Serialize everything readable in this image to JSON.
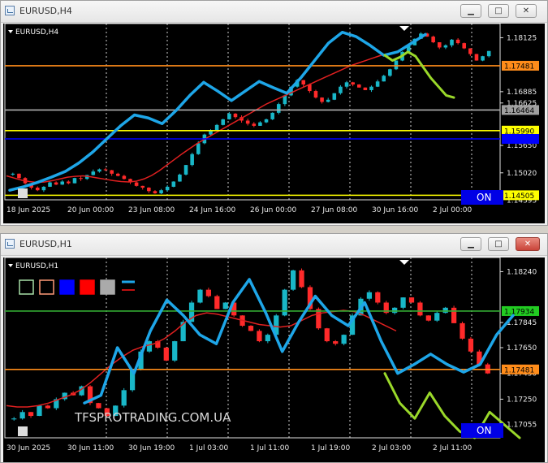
{
  "windows": [
    {
      "title": "EURUSD,H4",
      "symbol_label": "EURUSD,H4",
      "on_label": "ON",
      "chart_data": {
        "type": "candlestick",
        "symbol": "EURUSD",
        "timeframe": "H4",
        "ylim": [
          1.144,
          1.1845
        ],
        "y_ticks": [
          "1.18125",
          "1.16885",
          "1.16625",
          "1.15650",
          "1.15020",
          "1.14395"
        ],
        "y_tick_values": [
          1.18125,
          1.16885,
          1.16625,
          1.1565,
          1.1502,
          1.14395
        ],
        "x_ticks": [
          "18 Jun 2025",
          "20 Jun 00:00",
          "23 Jun 08:00",
          "24 Jun 16:00",
          "26 Jun 00:00",
          "27 Jun 08:00",
          "30 Jun 16:00",
          "2 Jul 00:00"
        ],
        "close_series": [
          1.15,
          1.149,
          1.1478,
          1.1468,
          1.1462,
          1.147,
          1.148,
          1.1475,
          1.1482,
          1.1478,
          1.149,
          1.1488,
          1.1497,
          1.1505,
          1.151,
          1.1508,
          1.15,
          1.1495,
          1.1488,
          1.148,
          1.1472,
          1.1468,
          1.146,
          1.1455,
          1.1462,
          1.147,
          1.1482,
          1.1498,
          1.152,
          1.1545,
          1.157,
          1.159,
          1.16,
          1.1612,
          1.1625,
          1.1638,
          1.163,
          1.1622,
          1.1615,
          1.161,
          1.1618,
          1.1625,
          1.164,
          1.166,
          1.168,
          1.17,
          1.1715,
          1.1705,
          1.169,
          1.1675,
          1.1665,
          1.167,
          1.1685,
          1.17,
          1.171,
          1.1705,
          1.1698,
          1.1692,
          1.17,
          1.1712,
          1.1725,
          1.174,
          1.176,
          1.178,
          1.1795,
          1.181,
          1.1822,
          1.1815,
          1.1802,
          1.179,
          1.1795,
          1.1808,
          1.18,
          1.1788,
          1.1775,
          1.176,
          1.177,
          1.1782
        ],
        "ma_series": [
          1.1495,
          1.149,
          1.1485,
          1.1482,
          1.148,
          1.1481,
          1.1484,
          1.1488,
          1.1492,
          1.1494,
          1.1495,
          1.1493,
          1.149,
          1.1487,
          1.1484,
          1.1482,
          1.1481,
          1.1483,
          1.1488,
          1.1496,
          1.1507,
          1.152,
          1.1533,
          1.1546,
          1.1558,
          1.157,
          1.158,
          1.159,
          1.16,
          1.161,
          1.162,
          1.163,
          1.164,
          1.165,
          1.166,
          1.1668,
          1.1676,
          1.1684,
          1.1692,
          1.17,
          1.1708,
          1.1716,
          1.1724,
          1.1732,
          1.174,
          1.1748,
          1.1754,
          1.176,
          1.1766,
          1.1772,
          1.1776,
          1.178
        ],
        "sketch_blue": [
          1.1462,
          1.147,
          1.148,
          1.1492,
          1.1505,
          1.1525,
          1.155,
          1.158,
          1.161,
          1.1635,
          1.1628,
          1.1615,
          1.1645,
          1.168,
          1.171,
          1.169,
          1.1668,
          1.169,
          1.1712,
          1.1698,
          1.1685,
          1.172,
          1.176,
          1.18,
          1.1825,
          1.1815,
          1.1795,
          1.1772,
          1.178,
          1.18,
          1.182
        ],
        "sketch_green": [
          1.1772,
          1.176,
          1.1768,
          1.178,
          1.177,
          1.1745,
          1.172,
          1.17,
          1.168,
          1.1675
        ],
        "hlines": [
          {
            "value": 1.17481,
            "label": "1.17481",
            "color": "#ff8c1a",
            "label_bg": "#ff8c1a"
          },
          {
            "value": 1.16464,
            "label": "1.16464",
            "color": "#b0b0b0",
            "label_bg": "#a0a0a0"
          },
          {
            "value": 1.1599,
            "label": "1.15990",
            "color": "#ffff00",
            "label_bg": "#ffff00"
          },
          {
            "value": 1.158,
            "label": "",
            "color": "#0000ff",
            "label_bg": "#0000ff"
          },
          {
            "value": 1.14505,
            "label": "1.14505",
            "color": "#ffff00",
            "label_bg": "#ffff00"
          }
        ]
      }
    },
    {
      "title": "EURUSD,H1",
      "symbol_label": "EURUSD,H1",
      "on_label": "ON",
      "watermark": "TFSPROTRADING.COM.UA",
      "chart_data": {
        "type": "candlestick",
        "symbol": "EURUSD",
        "timeframe": "H1",
        "ylim": [
          1.1695,
          1.1835
        ],
        "y_ticks": [
          "1.18240",
          "1.17845",
          "1.17650",
          "1.17450",
          "1.17250",
          "1.17055"
        ],
        "y_tick_values": [
          1.1824,
          1.17845,
          1.1765,
          1.1745,
          1.1725,
          1.17055
        ],
        "x_ticks": [
          "30 Jun 2025",
          "30 Jun 11:00",
          "30 Jun 19:00",
          "1 Jul 03:00",
          "1 Jul 11:00",
          "1 Jul 19:00",
          "2 Jul 03:00",
          "2 Jul 11:00"
        ],
        "close_series": [
          1.171,
          1.1715,
          1.1712,
          1.172,
          1.1718,
          1.1725,
          1.173,
          1.1728,
          1.1735,
          1.1722,
          1.1718,
          1.1712,
          1.172,
          1.1732,
          1.1748,
          1.1762,
          1.177,
          1.1765,
          1.1755,
          1.177,
          1.1785,
          1.18,
          1.181,
          1.1805,
          1.1795,
          1.18,
          1.179,
          1.1782,
          1.1778,
          1.177,
          1.1775,
          1.179,
          1.181,
          1.1825,
          1.1812,
          1.1795,
          1.178,
          1.177,
          1.1768,
          1.1775,
          1.179,
          1.1803,
          1.1808,
          1.18,
          1.1792,
          1.1796,
          1.1804,
          1.18,
          1.179,
          1.1786,
          1.1792,
          1.1796,
          1.1784,
          1.1772,
          1.1762,
          1.1752,
          1.1745
        ],
        "ma_series": [
          1.172,
          1.1719,
          1.1719,
          1.172,
          1.1722,
          1.1725,
          1.1728,
          1.1732,
          1.1738,
          1.1745,
          1.1752,
          1.1758,
          1.1763,
          1.1766,
          1.1768,
          1.1772,
          1.1778,
          1.1785,
          1.179,
          1.1792,
          1.1791,
          1.1789,
          1.1787,
          1.1785,
          1.1783,
          1.1782,
          1.1781,
          1.1782,
          1.1786,
          1.179,
          1.1792,
          1.1793,
          1.1794,
          1.1793,
          1.179,
          1.1786,
          1.1782,
          1.1778
        ],
        "sketch_blue": [
          1.1722,
          1.1728,
          1.1765,
          1.1745,
          1.1778,
          1.1802,
          1.179,
          1.1775,
          1.1768,
          1.18,
          1.1818,
          1.1792,
          1.1762,
          1.1785,
          1.1805,
          1.179,
          1.1782,
          1.18,
          1.177,
          1.1745,
          1.1752,
          1.176,
          1.1752,
          1.1746,
          1.1752,
          1.1775,
          1.179
        ],
        "sketch_green": [
          1.1745,
          1.1722,
          1.171,
          1.173,
          1.1712,
          1.17,
          1.1695,
          1.1715,
          1.1705,
          1.1695
        ],
        "hlines": [
          {
            "value": 1.17934,
            "label": "1.17934",
            "color": "#33aa33",
            "label_bg": "#22cc22"
          },
          {
            "value": 1.17481,
            "label": "1.17481",
            "color": "#ff8c1a",
            "label_bg": "#ff8c1a"
          }
        ],
        "legend_colors": [
          "#a8e0a8",
          "#ff9a78",
          "#0000ff",
          "#ff0000",
          "#aaaaaa"
        ]
      }
    }
  ]
}
